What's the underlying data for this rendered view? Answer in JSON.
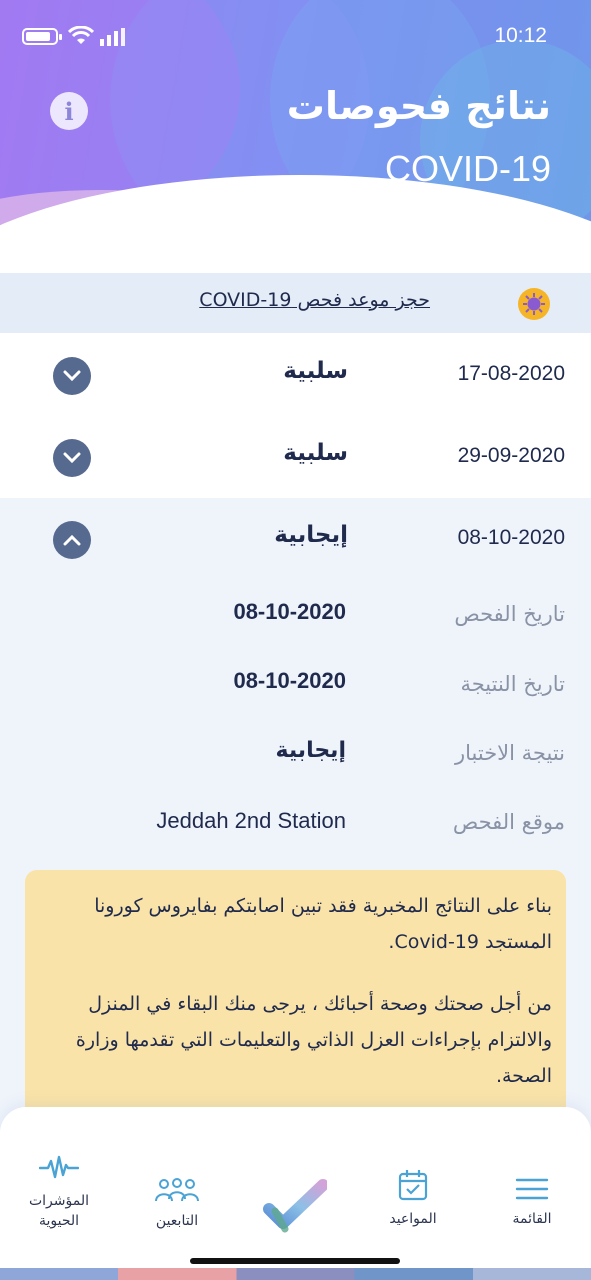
{
  "status_bar": {
    "time": "10:12"
  },
  "header": {
    "title_ar": "نتائج فحوصات",
    "title_en": "COVID-19"
  },
  "banner": {
    "link_text": "حجز موعد فحص COVID-19"
  },
  "results": [
    {
      "date": "17-08-2020",
      "result": "سلبية"
    },
    {
      "date": "29-09-2020",
      "result": "سلبية"
    },
    {
      "date": "08-10-2020",
      "result": "إيجابية"
    }
  ],
  "details": {
    "test_date_label": "تاريخ الفحص",
    "test_date_value": "08-10-2020",
    "result_date_label": "تاريخ النتيجة",
    "result_date_value": "08-10-2020",
    "test_result_label": "نتيجة الاختبار",
    "test_result_value": "إيجابية",
    "location_label": "موقع الفحص",
    "location_value": "Jeddah 2nd Station"
  },
  "notice": {
    "paragraph1": "بناء على النتائج المخبرية فقد تبين اصابتكم بفايروس كورونا المستجد Covid-19.",
    "paragraph2": "من أجل صحتك وصحة أحبائك ، يرجى منك البقاء في المنزل والالتزام بإجراءات العزل الذاتي والتعليمات التي تقدمها وزارة الصحة."
  },
  "tabbar": {
    "vitals_line1": "المؤشرات",
    "vitals_line2": "الحيوية",
    "dependents": "التابعين",
    "appointments": "المواعيد",
    "menu": "القائمة"
  },
  "colors": {
    "accent": "#56698f",
    "notice_bg": "#f9e3a8",
    "banner_bg": "#e3ecf7"
  }
}
